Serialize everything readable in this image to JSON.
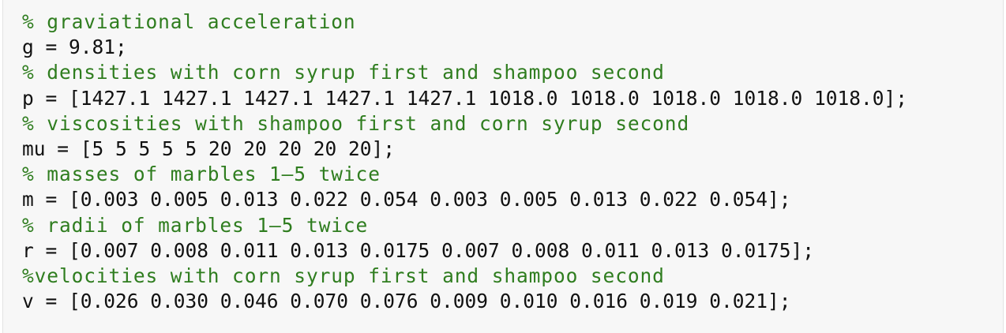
{
  "code": {
    "lines": [
      {
        "kind": "comment",
        "text": "% graviational acceleration"
      },
      {
        "kind": "statement",
        "text": "g = 9.81;"
      },
      {
        "kind": "comment",
        "text": "% densities with corn syrup first and shampoo second"
      },
      {
        "kind": "statement",
        "text": "p = [1427.1 1427.1 1427.1 1427.1 1427.1 1018.0 1018.0 1018.0 1018.0 1018.0];"
      },
      {
        "kind": "comment",
        "text": "% viscosities with shampoo first and corn syrup second"
      },
      {
        "kind": "statement",
        "text": "mu = [5 5 5 5 5 20 20 20 20 20];"
      },
      {
        "kind": "comment",
        "text": "% masses of marbles 1–5 twice"
      },
      {
        "kind": "statement",
        "text": "m = [0.003 0.005 0.013 0.022 0.054 0.003 0.005 0.013 0.022 0.054];"
      },
      {
        "kind": "comment",
        "text": "% radii of marbles 1–5 twice"
      },
      {
        "kind": "statement",
        "text": "r = [0.007 0.008 0.011 0.013 0.0175 0.007 0.008 0.011 0.013 0.0175];"
      },
      {
        "kind": "comment",
        "text": "%velocities with corn syrup first and shampoo second"
      },
      {
        "kind": "statement",
        "text": "v = [0.026 0.030 0.046 0.070 0.076 0.009 0.010 0.016 0.019 0.021];"
      }
    ]
  },
  "colors": {
    "comment": "#2f7d1f",
    "code": "#111111",
    "background": "#f7f7f7"
  }
}
